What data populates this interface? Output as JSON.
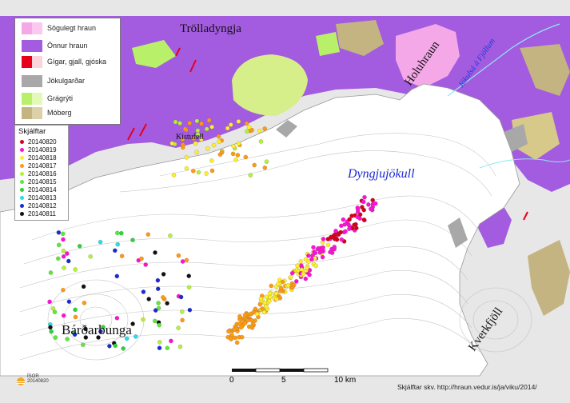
{
  "legend": {
    "items": [
      {
        "label": "Sögulegt hraun",
        "color": "#f5a8e8",
        "color2": "#fbc8f2"
      },
      {
        "label": "Önnur hraun",
        "color": "#a35be0"
      },
      {
        "label": "Gígar, gjall, gjóska",
        "color": "#e8001a",
        "color2": "#fcd4dc"
      },
      {
        "label": "Jökulgarðar",
        "color": "#a8a8a8"
      },
      {
        "label": "Grágrýti",
        "color": "#b8f06a",
        "color2": "#e2f9b8"
      },
      {
        "label": "Móberg",
        "color": "#c4b482",
        "color2": "#dcd0a8"
      }
    ]
  },
  "quakes": {
    "title": "Skjálftar",
    "items": [
      {
        "label": "20140820",
        "color": "#d6001c"
      },
      {
        "label": "20140819",
        "color": "#ff10d6"
      },
      {
        "label": "20140818",
        "color": "#ffef2a"
      },
      {
        "label": "20140817",
        "color": "#ff9a10"
      },
      {
        "label": "20140816",
        "color": "#b6f03a"
      },
      {
        "label": "20140815",
        "color": "#5ee83a"
      },
      {
        "label": "20140814",
        "color": "#2ad43a"
      },
      {
        "label": "20140813",
        "color": "#20e0f0"
      },
      {
        "label": "20140812",
        "color": "#1a2ad6"
      },
      {
        "label": "20140811",
        "color": "#111111"
      }
    ]
  },
  "places": {
    "trolladyngja": "Trölladyngja",
    "kistufell": "Kistufell",
    "holuhraun": "Holuhraun",
    "jokulsa": "Jökulsá á Fjöllum",
    "dyngjujokull": "Dyngjujökull",
    "bardarbunga": "Bárðarbunga",
    "kverkfjoll": "Kverkfjöll"
  },
  "scale": {
    "t0": "0",
    "t5": "5",
    "t10": "10 km"
  },
  "logo": {
    "name": "ÍSOR",
    "date": "20140820"
  },
  "source": "Skjálftar skv.  http://hraun.vedur.is/ja/viku/2014/",
  "colors": {
    "lava": "#a35be0",
    "glacier": "#ffffff",
    "outwash": "#e6e6e6",
    "moraine": "#a8a8a8",
    "contour": "#b8b8b8",
    "river": "#8fe8f0"
  }
}
